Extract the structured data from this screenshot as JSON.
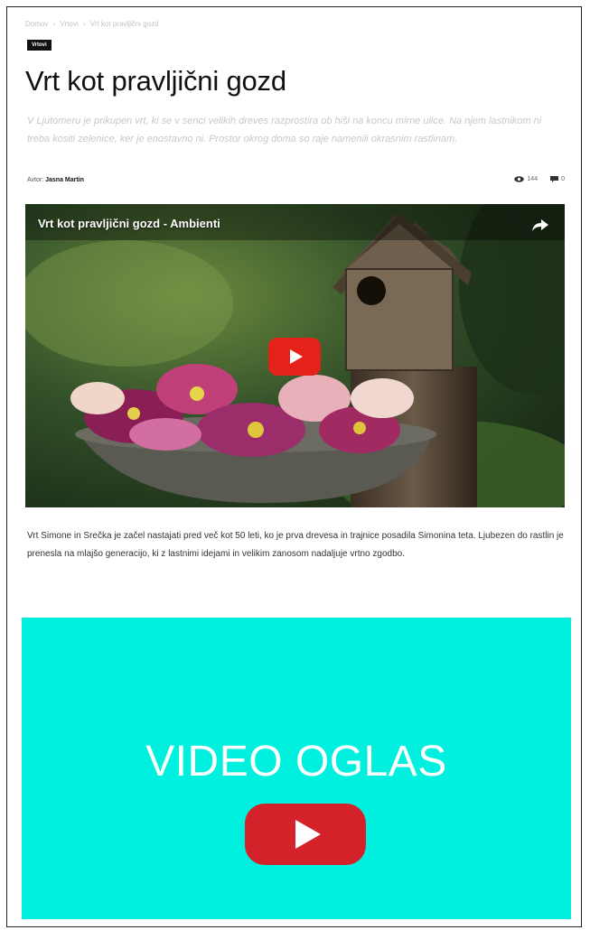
{
  "breadcrumb": [
    "Domov",
    "›",
    "Vrtovi",
    "›",
    "Vrt kot pravljični gozd"
  ],
  "category": "Vrtovi",
  "article": {
    "title": "Vrt kot pravljični gozd",
    "lead": "V Ljutomeru je prikupen vrt, ki se v senci velikih dreves razprostira ob hiši na koncu mirne ulice. Na njem lastnikom ni treba kositi zelenice, ker je enostavno ni. Prostor okrog doma so raje namenili okrasnim rastlinam.",
    "author_label": "Avtor:",
    "author_name": "Jasna Martin",
    "views": "144",
    "comments": "0",
    "body": "Vrt Simone in Srečka je začel nastajati pred več kot 50 leti, ko je prva drevesa in trajnice posadila Simonina teta. Ljubezen do rastlin je prenesla na mlajšo generacijo, ki z lastnimi idejami in velikim zanosom nadaljuje vrtno zgodbo."
  },
  "video": {
    "title": "Vrt kot pravljični gozd - Ambienti",
    "share_icon": "share-arrow-icon",
    "play_icon": "youtube-play-icon"
  },
  "ad": {
    "label": "VIDEO OGLAS",
    "background": "#00f0e0",
    "play_color": "#d4222a"
  },
  "colors": {
    "title": "#111111",
    "lead": "#c8c8c8",
    "youtube_red": "#e5221a"
  }
}
